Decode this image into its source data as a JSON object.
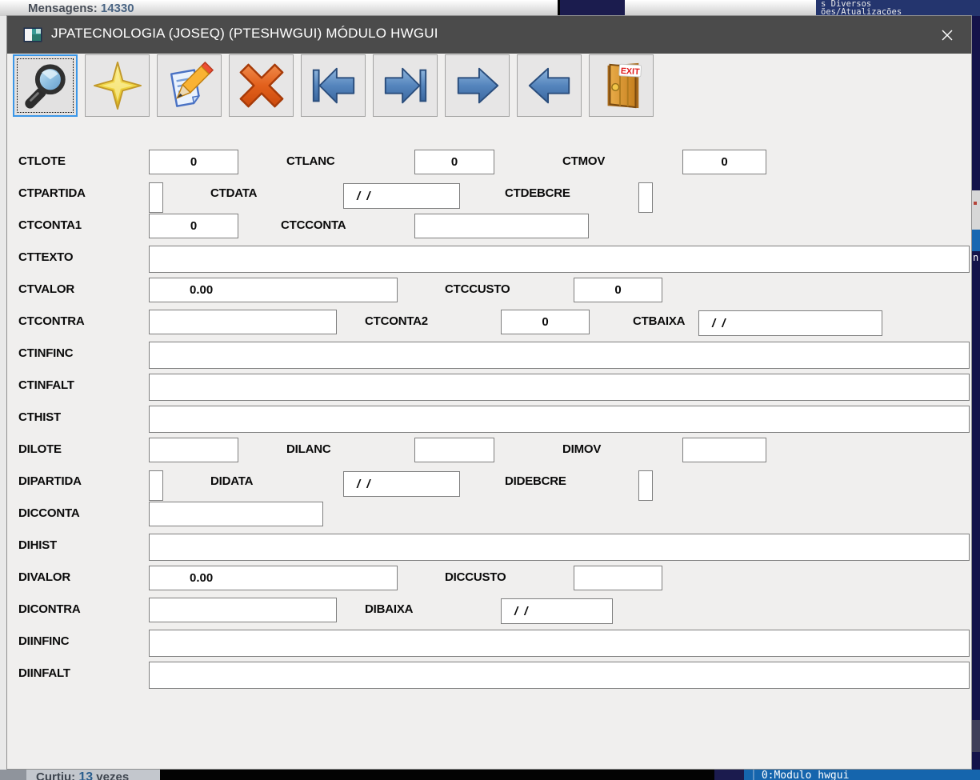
{
  "background": {
    "messages_prefix": "Mensagens:",
    "messages_count": "14330",
    "terminal_line1": "s Diversos",
    "terminal_line2": "ões/Atualizações",
    "curtiu_prefix": "Curtiu:",
    "curtiu_count": "13",
    "curtiu_suffix": "vezes",
    "tmux_separator": "│",
    "tmux_status": "0:Modulo hwgui",
    "right_strip_char": "n"
  },
  "window": {
    "title": "JPATECNOLOGIA (JOSEQ) (PTESHWGUI) MÓDULO HWGUI"
  },
  "colors": {
    "titlebar": "#4b4b4b",
    "focus_border": "#3b97e8",
    "status_bar_blue": "#1565ad",
    "arrow_blue": "#3e6da8",
    "delete_orange": "#d44d0c",
    "star_yellow": "#e8c820",
    "door_orange": "#d2912e"
  },
  "toolbar": {
    "exit_label": "EXIT",
    "buttons": [
      {
        "name": "search",
        "icon": "magnifier-icon",
        "focused": true
      },
      {
        "name": "new",
        "icon": "star-icon",
        "focused": false
      },
      {
        "name": "edit",
        "icon": "edit-document-icon",
        "focused": false
      },
      {
        "name": "delete",
        "icon": "delete-x-icon",
        "focused": false
      },
      {
        "name": "first",
        "icon": "arrow-first-icon",
        "focused": false
      },
      {
        "name": "last",
        "icon": "arrow-last-icon",
        "focused": false
      },
      {
        "name": "next",
        "icon": "arrow-next-icon",
        "focused": false
      },
      {
        "name": "previous",
        "icon": "arrow-previous-icon",
        "focused": false
      },
      {
        "name": "exit",
        "icon": "exit-door-icon",
        "focused": false
      }
    ]
  },
  "form": {
    "fields": {
      "CTLOTE": {
        "label": "CTLOTE",
        "value": "0"
      },
      "CTLANC": {
        "label": "CTLANC",
        "value": "0"
      },
      "CTMOV": {
        "label": "CTMOV",
        "value": "0"
      },
      "CTPARTIDA": {
        "label": "CTPARTIDA",
        "value": ""
      },
      "CTDATA": {
        "label": "CTDATA",
        "value": "/ /"
      },
      "CTDEBCRE": {
        "label": "CTDEBCRE",
        "value": ""
      },
      "CTCONTA1": {
        "label": "CTCONTA1",
        "value": "0"
      },
      "CTCCONTA": {
        "label": "CTCCONTA",
        "value": ""
      },
      "CTTEXTO": {
        "label": "CTTEXTO",
        "value": ""
      },
      "CTVALOR": {
        "label": "CTVALOR",
        "value": "0.00"
      },
      "CTCCUSTO": {
        "label": "CTCCUSTO",
        "value": "0"
      },
      "CTCONTRA": {
        "label": "CTCONTRA",
        "value": ""
      },
      "CTCONTA2": {
        "label": "CTCONTA2",
        "value": "0"
      },
      "CTBAIXA": {
        "label": "CTBAIXA",
        "value": "/ /"
      },
      "CTINFINC": {
        "label": "CTINFINC",
        "value": ""
      },
      "CTINFALT": {
        "label": "CTINFALT",
        "value": ""
      },
      "CTHIST": {
        "label": "CTHIST",
        "value": ""
      },
      "DILOTE": {
        "label": "DILOTE",
        "value": ""
      },
      "DILANC": {
        "label": "DILANC",
        "value": ""
      },
      "DIMOV": {
        "label": "DIMOV",
        "value": ""
      },
      "DIPARTIDA": {
        "label": "DIPARTIDA",
        "value": ""
      },
      "DIDATA": {
        "label": "DIDATA",
        "value": "/ /"
      },
      "DIDEBCRE": {
        "label": "DIDEBCRE",
        "value": ""
      },
      "DICCONTA": {
        "label": "DICCONTA",
        "value": ""
      },
      "DIHIST": {
        "label": "DIHIST",
        "value": ""
      },
      "DIVALOR": {
        "label": "DIVALOR",
        "value": "0.00"
      },
      "DICCUSTO": {
        "label": "DICCUSTO",
        "value": ""
      },
      "DICONTRA": {
        "label": "DICONTRA",
        "value": ""
      },
      "DIBAIXA": {
        "label": "DIBAIXA",
        "value": "/ /"
      },
      "DIINFINC": {
        "label": "DIINFINC",
        "value": ""
      },
      "DIINFALT": {
        "label": "DIINFALT",
        "value": ""
      }
    }
  }
}
